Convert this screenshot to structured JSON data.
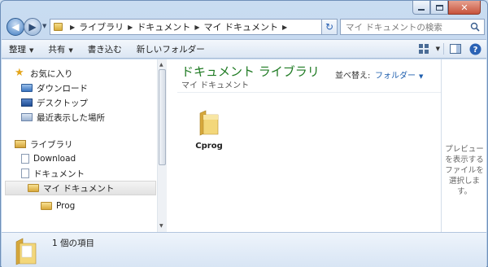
{
  "address": {
    "crumbs": [
      "ライブラリ",
      "ドキュメント",
      "マイ ドキュメント"
    ]
  },
  "search": {
    "placeholder": "マイ ドキュメントの検索"
  },
  "toolbar": {
    "organize": "整理",
    "share": "共有",
    "burn": "書き込む",
    "new_folder": "新しいフォルダー"
  },
  "sidebar": {
    "favorites": "お気に入り",
    "downloads": "ダウンロード",
    "desktop": "デスクトップ",
    "recent": "最近表示した場所",
    "libraries": "ライブラリ",
    "download_lib": "Download",
    "documents": "ドキュメント",
    "my_documents": "マイ ドキュメント",
    "prog": "Prog"
  },
  "main": {
    "library_title": "ドキュメント ライブラリ",
    "library_subtitle": "マイ ドキュメント",
    "sort_label": "並べ替え:",
    "sort_value": "フォルダー",
    "items": [
      {
        "name": "Cprog"
      }
    ]
  },
  "preview": {
    "text": "プレビューを表示するファイルを選択します。"
  },
  "details": {
    "count_text": "1 個の項目"
  }
}
